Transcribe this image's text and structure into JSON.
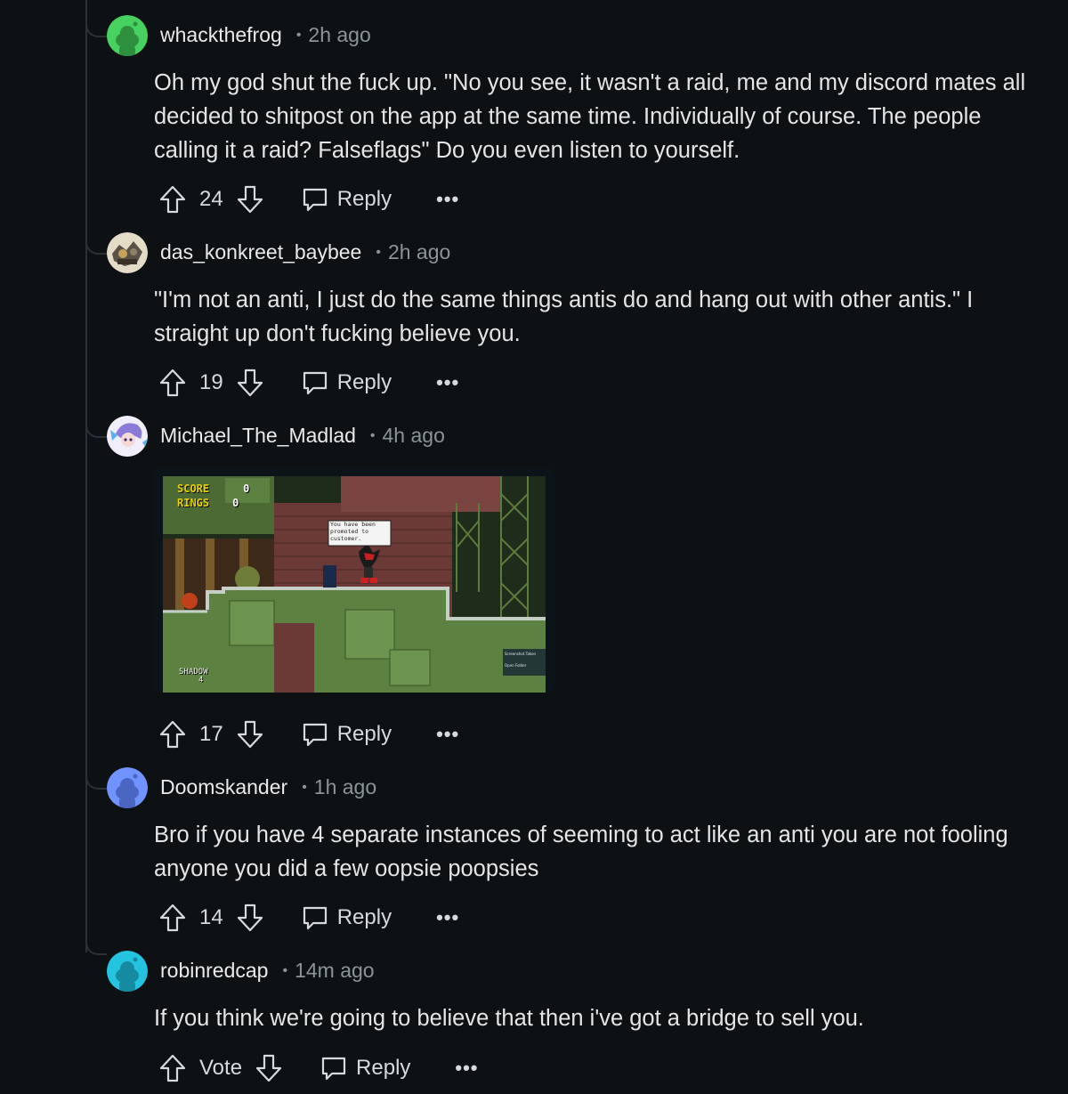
{
  "comments": [
    {
      "username": "whackthefrog",
      "time": "2h ago",
      "text": "Oh my god shut the fuck up. \"No you see, it wasn't a raid, me and my discord mates all decided to shitpost on the app at the same time. Individually of course. The people calling it a raid? Falseflags\" Do you even listen to yourself.",
      "score": "24",
      "reply_label": "Reply",
      "avatar_color": "#46d160"
    },
    {
      "username": "das_konkreet_baybee",
      "time": "2h ago",
      "text": "\"I'm not an anti, I just do the same things antis do and hang out with other antis.\" I straight up don't fucking believe you.",
      "score": "19",
      "reply_label": "Reply",
      "avatar_color": "#c8b48a"
    },
    {
      "username": "Michael_The_Madlad",
      "time": "4h ago",
      "score": "17",
      "reply_label": "Reply",
      "avatar_color": "#dcd6ff",
      "image": {
        "hud_score_label": "SCORE",
        "hud_score_value": "0",
        "hud_rings_label": "RINGS",
        "hud_rings_value": "0",
        "dialog_text": "You have been promoted to customer.",
        "lives_label": "SHADOW",
        "lives_value": "4",
        "toast_title": "Screenshot Taken",
        "toast_button": "Open Folder"
      }
    },
    {
      "username": "Doomskander",
      "time": "1h ago",
      "text": "Bro if you have 4 separate instances of seeming to act like an anti you are not fooling anyone you did a few oopsie poopsies",
      "score": "14",
      "reply_label": "Reply",
      "avatar_color": "#7193ff"
    },
    {
      "username": "robinredcap",
      "time": "14m ago",
      "text": "If you think we're going to believe that then i've got a bridge to sell you.",
      "score": "Vote",
      "reply_label": "Reply",
      "avatar_color": "#24c4e0"
    }
  ],
  "dot_separator": "•",
  "more_label": "•••",
  "icons": [
    "upvote-icon",
    "downvote-icon",
    "reply-bubble-icon",
    "more-options-icon",
    "snoo-avatar-icon"
  ]
}
